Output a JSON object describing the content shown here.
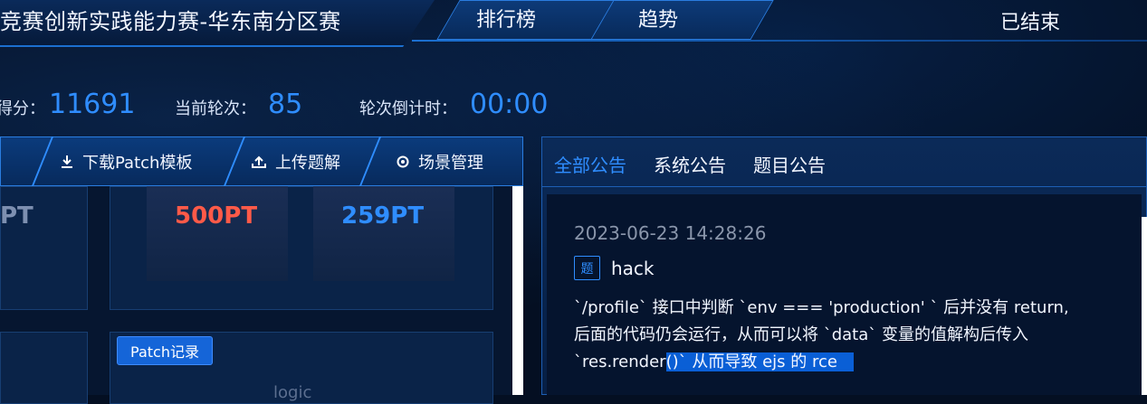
{
  "header": {
    "title": "竞赛创新实践能力赛-华东南分区赛",
    "tabs": [
      "排行榜",
      "趋势"
    ],
    "status": "已结束"
  },
  "stats": {
    "score_label": "得分：",
    "score_value": "11691",
    "round_label": "当前轮次：",
    "round_value": "85",
    "countdown_label": "轮次倒计时：",
    "countdown_value": "00:00"
  },
  "toolbar": {
    "download_label": "下载Patch模板",
    "upload_label": "上传题解",
    "scene_label": "场景管理"
  },
  "cards": {
    "pt_left": "PT",
    "pt_red": "500PT",
    "pt_blue": "259PT",
    "patch_record": "Patch记录",
    "partial_text": "logic"
  },
  "announcements": {
    "tabs": [
      "全部公告",
      "系统公告",
      "题目公告"
    ],
    "item": {
      "time": "2023-06-23 14:28:26",
      "tag": "题",
      "name": "hack",
      "line1": "`/profile` 接口中判断 `env === 'production' ` 后并没有 return,",
      "line2": "后面的代码仍会运行，从而可以将 `data` 变量的值解构后传入",
      "line3_a": "`res.render",
      "line3_b": "()` 从而导致 ejs 的 rce"
    }
  },
  "colors": {
    "accent": "#2f8dff",
    "red_pt": "#ff5a48",
    "blue_pt": "#2f8dff",
    "selection": "#0a5fd6"
  }
}
